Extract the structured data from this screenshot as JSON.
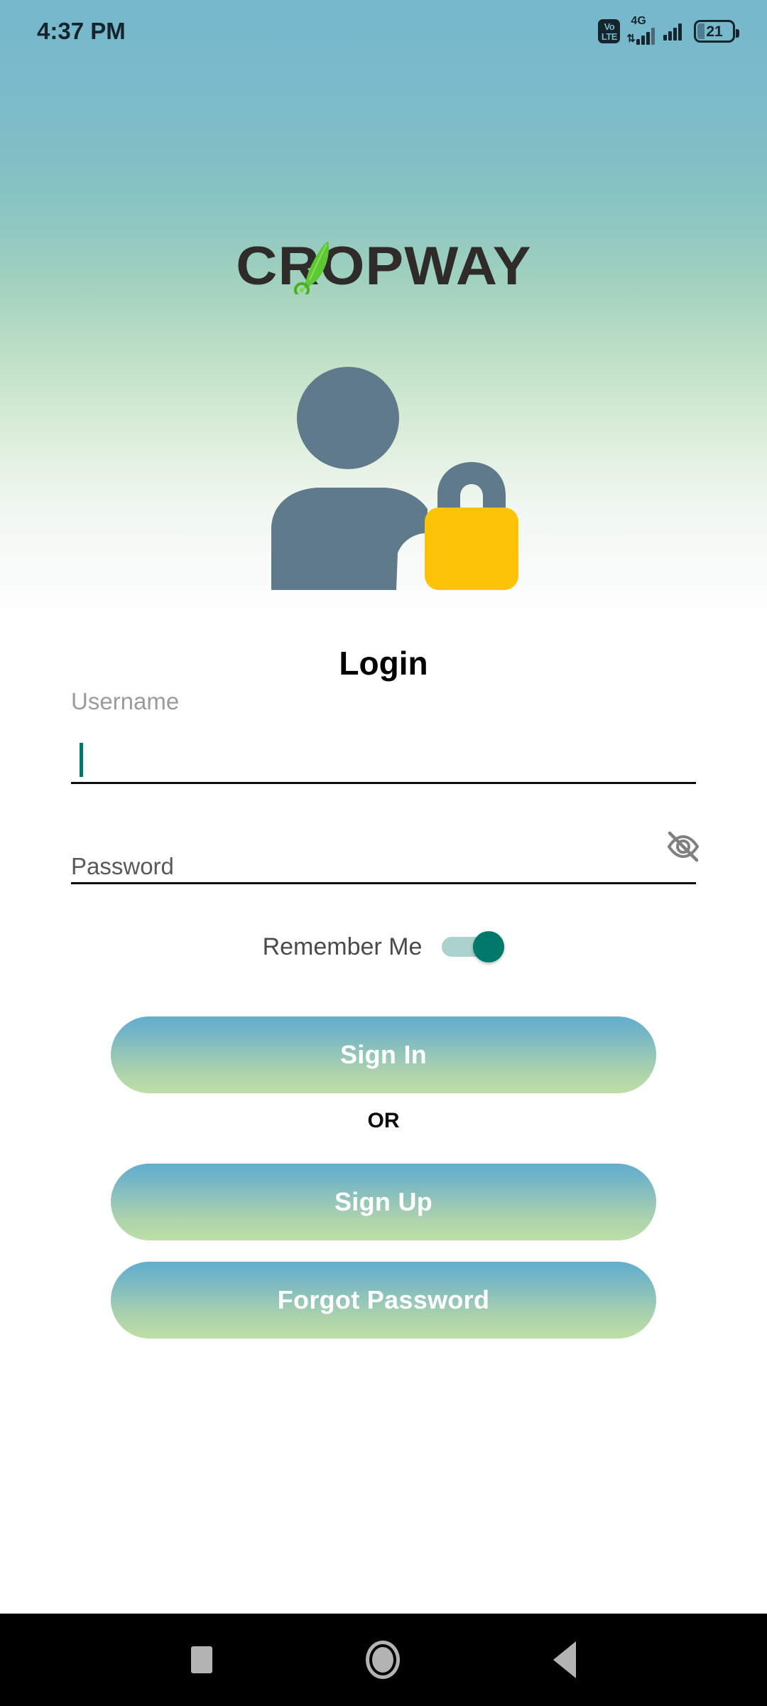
{
  "status_bar": {
    "time": "4:37 PM",
    "volte_top": "Vo",
    "volte_bottom": "LTE",
    "network_label": "4G",
    "data_arrows": "⇅",
    "battery_percent": "21"
  },
  "brand": {
    "logo_text": "CROPWAY",
    "logo_color": "#2F2B28",
    "leaf_color": "#5CC832"
  },
  "hero": {
    "person_color": "#5F7A8A",
    "lock_color": "#FCC307"
  },
  "form": {
    "title": "Login",
    "username_label": "Username",
    "username_value": "",
    "username_placeholder": "",
    "password_placeholder": "Password",
    "password_value": "",
    "password_visibility_icon": "eye-off-icon",
    "remember_label": "Remember Me",
    "remember_checked": true,
    "caret_color": "#00796B",
    "toggle_on_color": "#00796B"
  },
  "actions": {
    "sign_in": "Sign In",
    "divider": "OR",
    "sign_up": "Sign Up",
    "forgot_password": "Forgot Password",
    "gradient_start": "#63AECD",
    "gradient_end": "#BDDFA7"
  },
  "nav_bar": {
    "recents": "recents-square-icon",
    "home": "home-circle-icon",
    "back": "back-triangle-icon"
  }
}
